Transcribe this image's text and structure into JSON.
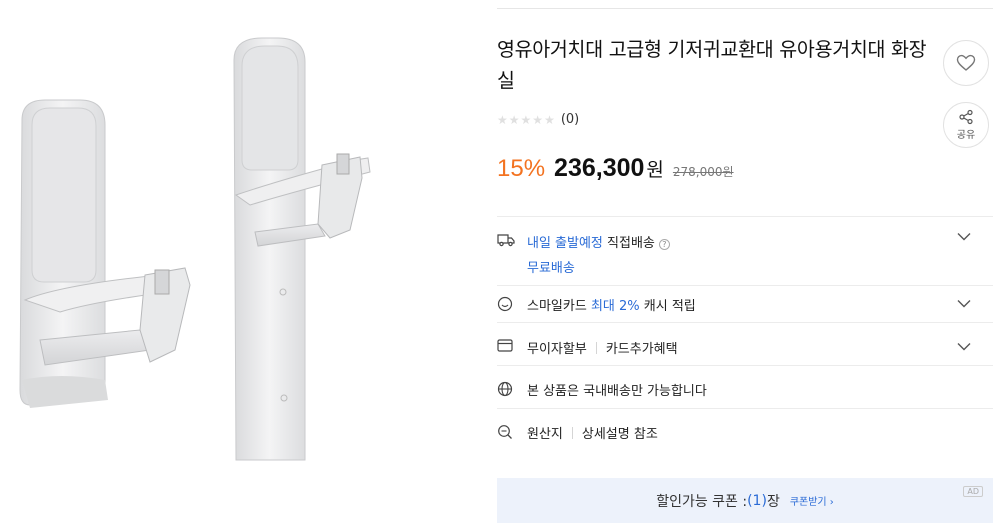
{
  "product": {
    "title": "영유아거치대 고급형 기저귀교환대 유아용거치대 화장실",
    "image_alt": "baby-seat-product-image",
    "rating_count": "(0)",
    "discount_rate": "15%",
    "price": "236,300",
    "price_unit": "원",
    "original_price": "278,000원"
  },
  "actions": {
    "share_label": "공유"
  },
  "delivery": {
    "arrival": "내일 출발예정",
    "method": "직접배송",
    "fee": "무료배송"
  },
  "smilecard": {
    "prefix": "스마일카드",
    "highlight": "최대 2%",
    "suffix": "캐시 적립"
  },
  "installment": {
    "label": "무이자할부",
    "benefit": "카드추가혜택"
  },
  "shipping_notice": "본 상품은 국내배송만 가능합니다",
  "origin": {
    "label": "원산지",
    "value": "상세설명 참조"
  },
  "coupon": {
    "prefix": "할인가능 쿠폰 : ",
    "count": "(1)",
    "suffix": "장",
    "link": "쿠폰받기 ›",
    "ad_badge": "AD"
  },
  "colors": {
    "discount": "#f37321",
    "accent_blue": "#2a6bd6",
    "coupon_bg": "#edf2fb"
  }
}
